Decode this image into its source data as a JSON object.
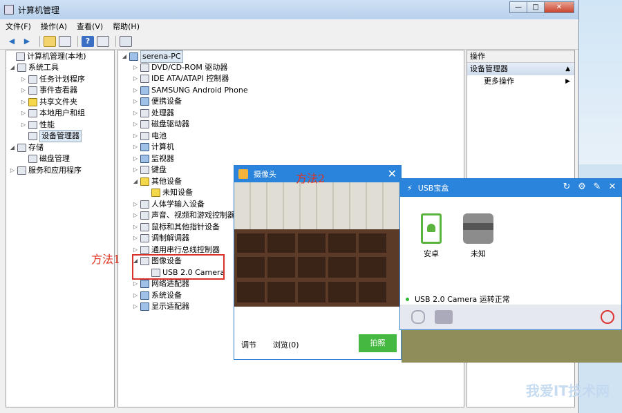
{
  "window": {
    "title": "计算机管理"
  },
  "menu": [
    "文件(F)",
    "操作(A)",
    "查看(V)",
    "帮助(H)"
  ],
  "left_tree": [
    {
      "label": "计算机管理(本地)"
    },
    {
      "label": "系统工具"
    },
    {
      "label": "任务计划程序"
    },
    {
      "label": "事件查看器"
    },
    {
      "label": "共享文件夹"
    },
    {
      "label": "本地用户和组"
    },
    {
      "label": "性能"
    },
    {
      "label": "设备管理器"
    },
    {
      "label": "存储"
    },
    {
      "label": "磁盘管理"
    },
    {
      "label": "服务和应用程序"
    }
  ],
  "device_tree": {
    "root": "serena-PC",
    "items": [
      "DVD/CD-ROM 驱动器",
      "IDE ATA/ATAPI 控制器",
      "SAMSUNG Android Phone",
      "便携设备",
      "处理器",
      "磁盘驱动器",
      "电池",
      "计算机",
      "监视器",
      "键盘",
      "其他设备",
      "未知设备",
      "人体学输入设备",
      "声音、视频和游戏控制器",
      "鼠标和其他指针设备",
      "调制解调器",
      "通用串行总线控制器",
      "图像设备",
      "USB 2.0 Camera",
      "网络适配器",
      "系统设备",
      "显示适配器"
    ]
  },
  "actions": {
    "header": "操作",
    "section": "设备管理器",
    "more": "更多操作"
  },
  "annotations": {
    "method1": "方法1",
    "method2": "方法2"
  },
  "camera_popup": {
    "title": "摄像头",
    "adjust": "调节",
    "browse": "浏览(0)",
    "capture": "拍照"
  },
  "usb_popup": {
    "title": "USB宝盒",
    "devices": [
      {
        "label": "安卓"
      },
      {
        "label": "未知"
      }
    ],
    "status": "USB 2.0 Camera 运转正常"
  },
  "watermark": "我爱IT技术网",
  "colors": {
    "accent_blue": "#2b84db",
    "capture_green": "#44b840",
    "annotation_red": "#d9302c"
  }
}
